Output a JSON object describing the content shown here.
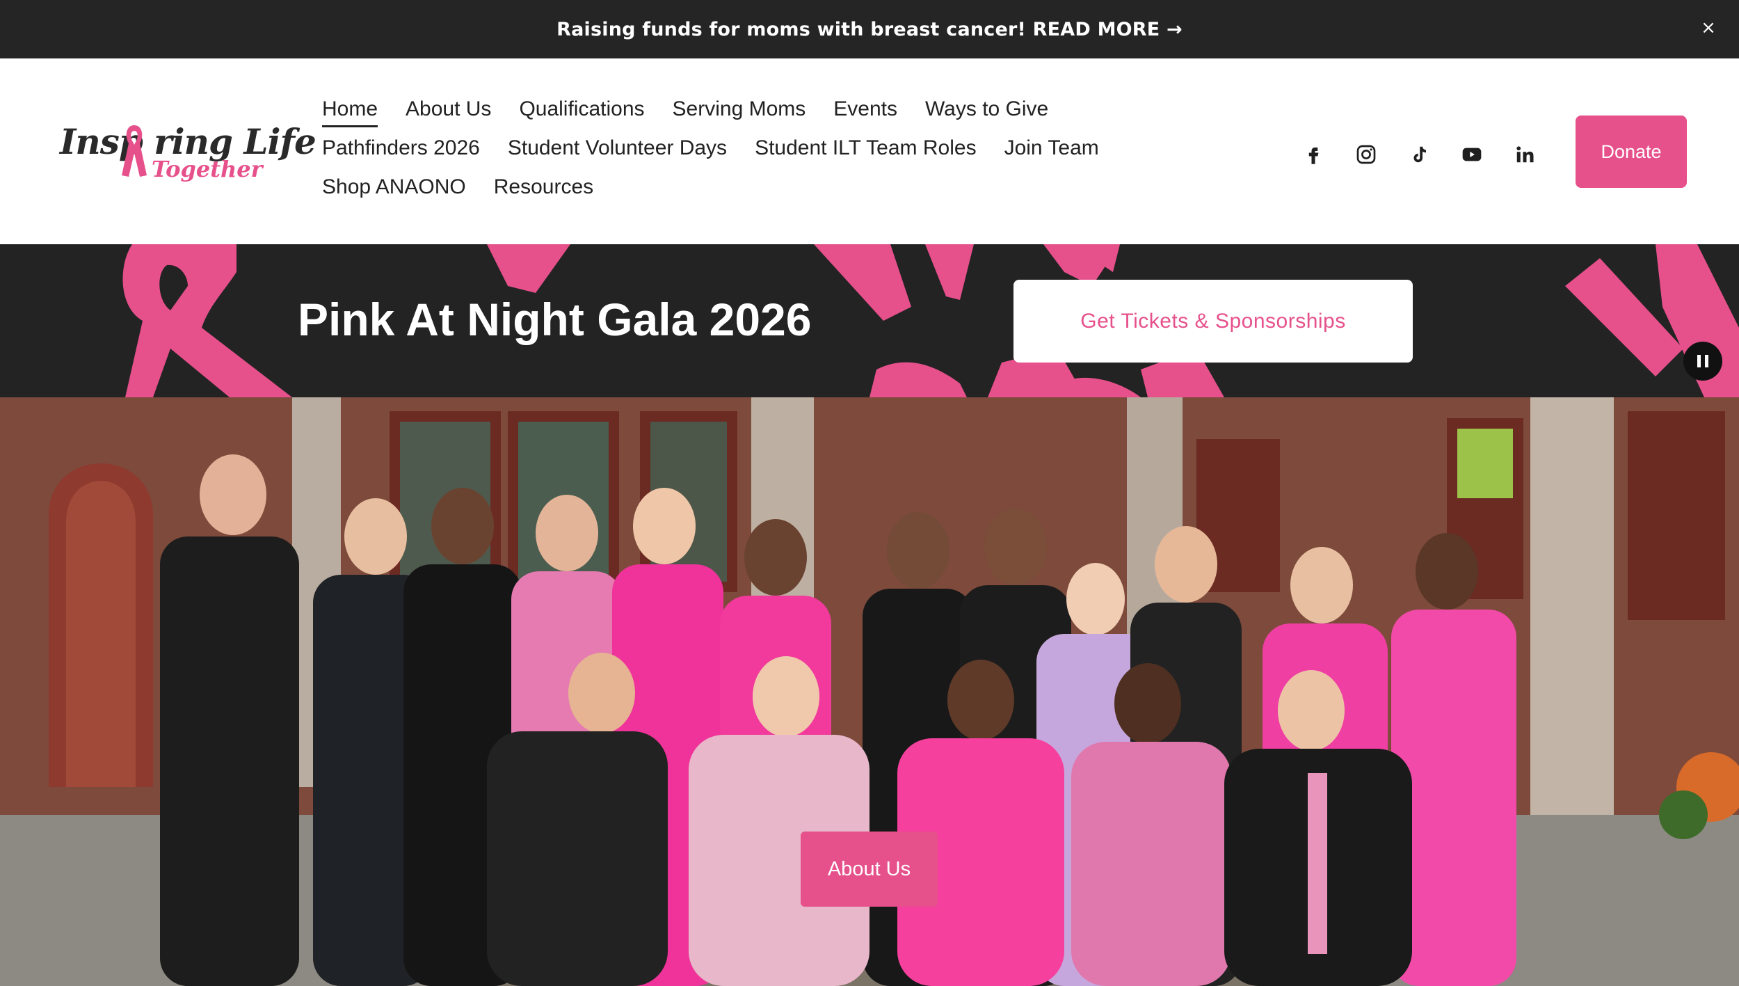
{
  "announcement": {
    "text": "Raising funds for moms with breast cancer! READ MORE →",
    "close_symbol": "×"
  },
  "brand": {
    "logo_main": "Insp ring Life",
    "logo_sub": "Together",
    "accent": "#e6508b",
    "dark": "#252525"
  },
  "nav": {
    "rows": [
      [
        "Home",
        "About Us",
        "Qualifications",
        "Serving Moms",
        "Events",
        "Ways to Give"
      ],
      [
        "Pathfinders 2026",
        "Student Volunteer Days",
        "Student ILT Team Roles",
        "Join Team"
      ],
      [
        "Shop ANAONO",
        "Resources"
      ]
    ],
    "active": "Home"
  },
  "socials": [
    "facebook-icon",
    "instagram-icon",
    "tiktok-icon",
    "youtube-icon",
    "linkedin-icon"
  ],
  "donate_label": "Donate",
  "promo": {
    "title": "Pink At Night Gala 2026",
    "button_label": "Get Tickets & Sponsorships"
  },
  "hero": {
    "button_label": "About Us"
  }
}
